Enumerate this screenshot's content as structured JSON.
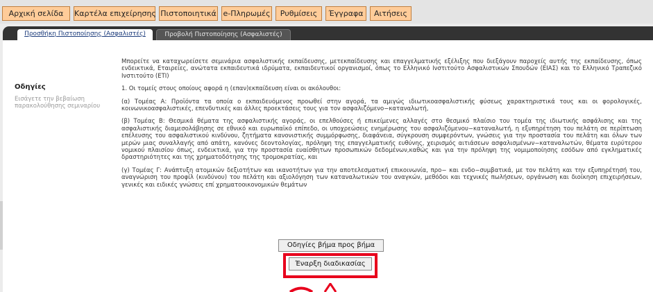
{
  "nav": {
    "items": [
      {
        "label": "Αρχική σελίδα"
      },
      {
        "label": "Καρτέλα επιχείρησης"
      },
      {
        "label": "Πιστοποιητικά"
      },
      {
        "label": "e-Πληρωμές"
      },
      {
        "label": "Ρυθμίσεις"
      },
      {
        "label": "Έγγραφα"
      },
      {
        "label": "Αιτήσεις"
      }
    ]
  },
  "tabs": [
    {
      "label": "Προσθήκη Πιστοποίησης (Ασφαλιστές)",
      "active": true
    },
    {
      "label": "Προβολή Πιστοποίησης (Ασφαλιστές)",
      "active": false
    }
  ],
  "sidebar": {
    "title": "Οδηγίες",
    "subtitle": "Εισάγετε την βεβαίωση παρακολούθησης σεμιναρίου"
  },
  "content": {
    "paragraphs": [
      "Μπορείτε να καταχωρείσετε σεμινάρια ασφαλιστικής εκπαίδευσης, μετεκπαίδευσης και επαγγελματικής εξέλιξης που διεξάγουν παροχείς αυτής της εκπαίδευσης, όπως ενδεικτικά, Εταιρείες, ανώτατα εκπαιδευτικά ιδρύματα, εκπαιδευτικοί οργανισμοί, όπως το Ελληνικό Ινστιτούτο Ασφαλιστικών Σπουδών (ΕΙΑΣ) και το Ελληνικό Τραπεζικό Ινστιτούτο (ΕΤΙ)",
      "1. Οι τομείς στους οποίους αφορά η (επαν)εκπαίδευση είναι οι ακόλουθοι:",
      "(α) Τομέας Α: Προϊόντα τα οποία ο εκπαιδευόμενος προωθεί στην αγορά, τα αμιγώς ιδιωτικοασφαλιστικής φύσεως χαρακτηριστικά τους και οι φορολογικές, κοινωνικοασφαλιστικές, επενδυτικές και άλλες προεκτάσεις τους για τον ασφαλιζόμενο−καταναλωτή,",
      "(β) Τομέας Β: Θεσμικά θέματα της ασφαλιστικής αγοράς, οι επελθούσες ή επικείμενες αλλαγές στο θεσμικό πλαίσιο του τομέα της ιδιωτικής ασφάλισης και της ασφαλιστικής διαμεσολάβησης σε εθνικό και ευρωπαϊκό επίπεδο, οι υποχρεώσεις ενημέρωσης του ασφαλιζόμενου−καταναλωτή, η εξυπηρέτηση του πελάτη σε περίπτωση επέλευσης του ασφαλιστικού κινδύνου, ζητήματα κανονιστικής συμμόρφωσης, διαφάνεια, σύγκρουση συμφερόντων, γνώσεις για την προστασία του πελάτη και όλων των μερών μιας συναλλαγής από απάτη, κανόνες δεοντολογίας, πρόληψη της επαγγελματικής ευθύνης, χειρισμός αιτιάσεων ασφαλισμένων−καταναλωτών, θέματα ευρύτερου νομικού πλαισίου όπως, ενδεικτικά, για την προστασία ευαίσθητων προσωπικών δεδομένων,καθώς και για την πρόληψη της νομιμοποίησης εσόδων από εγκληματικές δραστηριότητες και της χρηματοδότησης της τρομοκρατίας, και",
      "(γ) Τομέας Γ: Ανάπτυξη ατομικών δεξιοτήτων και ικανοτήτων για την αποτελεσματική επικοινωνία, προ− και ενδο−συμβατικά, με τον πελάτη και την εξυπηρέτησή του, αναγνώριση του προφίλ (κινδύνου) του πελάτη και αξιολόγηση των καταναλωτικών του αναγκών, μεθόδοι και τεχνικές πωλήσεων, οργάνωση και διοίκηση επιχειρήσεων, γενικές και ειδικές γνώσεις επί χρηματοοικονομικών θεμάτων"
    ]
  },
  "buttons": {
    "guide_label": "Οδηγίες βήμα προς βήμα",
    "start_label": "Έναρξη διαδικασίας"
  },
  "colors": {
    "nav_bg": "#ffcc99",
    "tabstrip_bg": "#333333",
    "highlight": "#e8001c"
  }
}
